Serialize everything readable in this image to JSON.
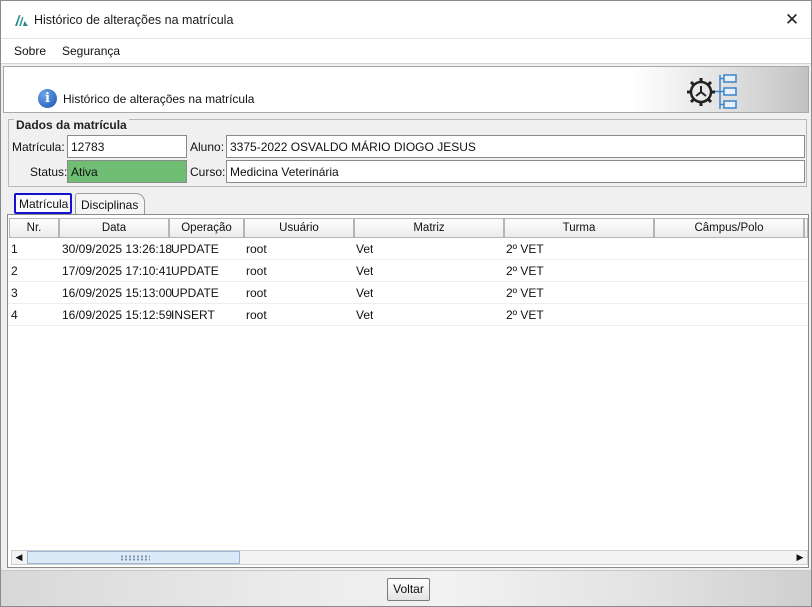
{
  "window": {
    "title": "Histórico de alterações na matrícula"
  },
  "menu": [
    "Sobre",
    "Segurança"
  ],
  "banner": {
    "text": "Histórico de alterações na matrícula"
  },
  "dados": {
    "legend": "Dados da matrícula",
    "matricula_label": "Matrícula:",
    "matricula_value": "12783",
    "aluno_label": "Aluno:",
    "aluno_value": "3375-2022 OSVALDO MÁRIO DIOGO JESUS",
    "status_label": "Status:",
    "status_value": "Ativa",
    "status_color": "#70be74",
    "curso_label": "Curso:",
    "curso_value": "Medicina Veterinária"
  },
  "tabs": [
    "Matrícula",
    "Disciplinas"
  ],
  "table": {
    "columns": [
      "Nr.",
      "Data",
      "Operação",
      "Usuário",
      "Matriz",
      "Turma",
      "Câmpus/Polo"
    ],
    "rows": [
      [
        "1",
        "30/09/2025 13:26:18",
        "UPDATE",
        "root",
        "Vet",
        "2º VET",
        ""
      ],
      [
        "2",
        "17/09/2025 17:10:41",
        "UPDATE",
        "root",
        "Vet",
        "2º VET",
        ""
      ],
      [
        "3",
        "16/09/2025 15:13:00",
        "UPDATE",
        "root",
        "Vet",
        "2º VET",
        ""
      ],
      [
        "4",
        "16/09/2025 15:12:59",
        "INSERT",
        "root",
        "Vet",
        "2º VET",
        ""
      ]
    ]
  },
  "footer": {
    "voltar_label": "Voltar"
  },
  "icons": {
    "close": "close-icon",
    "info": "info-icon",
    "gear": "gear-network-icon",
    "logo": "app-logo-icon"
  }
}
